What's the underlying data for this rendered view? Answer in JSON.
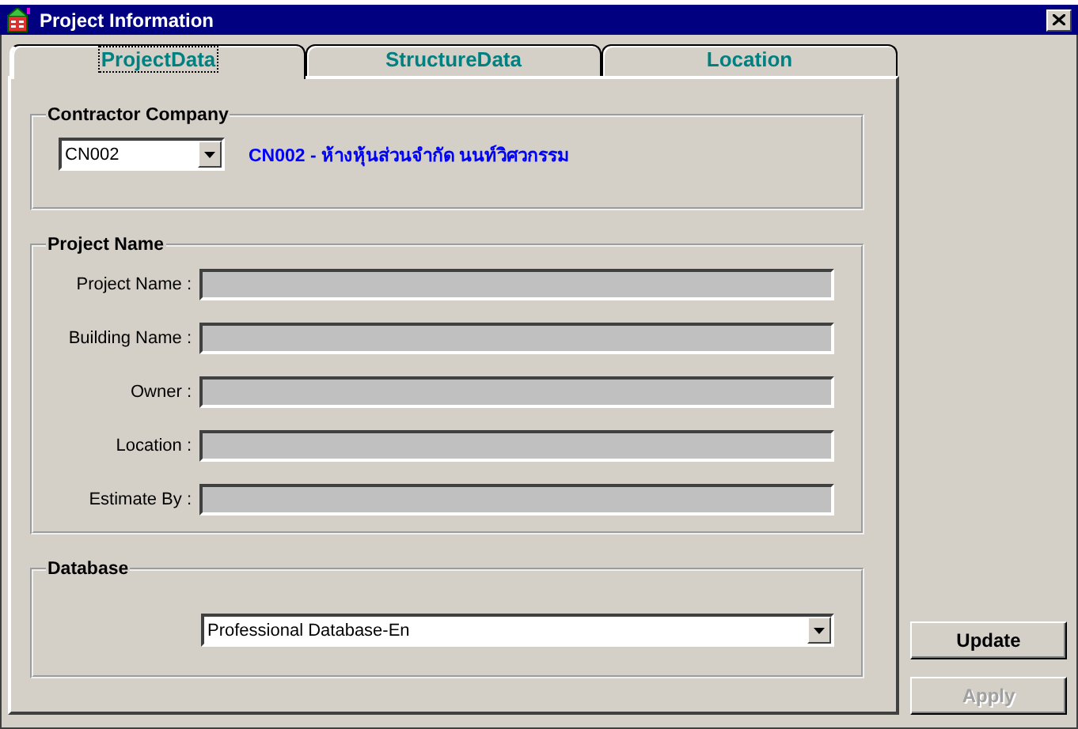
{
  "window": {
    "title": "Project Information"
  },
  "tabs": [
    {
      "label": "ProjectData",
      "selected": true
    },
    {
      "label": "StructureData",
      "selected": false
    },
    {
      "label": "Location",
      "selected": false
    }
  ],
  "contractor_company": {
    "label": "Contractor Company",
    "combo": {
      "value": "CN002"
    },
    "description": "CN002 - ห้างหุ้นส่วนจำกัด นนท์วิศวกรรม"
  },
  "project_name": {
    "label": "Project Name",
    "fields": [
      {
        "label": "Project Name :",
        "disabled": true
      },
      {
        "label": "Building Name :",
        "disabled": true
      },
      {
        "label": "Owner :",
        "disabled": true
      },
      {
        "label": "Location :",
        "disabled": true
      },
      {
        "label": "Estimate By :",
        "disabled": true
      }
    ]
  },
  "database": {
    "label": "Database",
    "combo": {
      "value": "Professional Database-En"
    }
  },
  "buttons": [
    {
      "label": "Update",
      "disabled": false
    },
    {
      "label": "Apply",
      "disabled": true
    }
  ]
}
